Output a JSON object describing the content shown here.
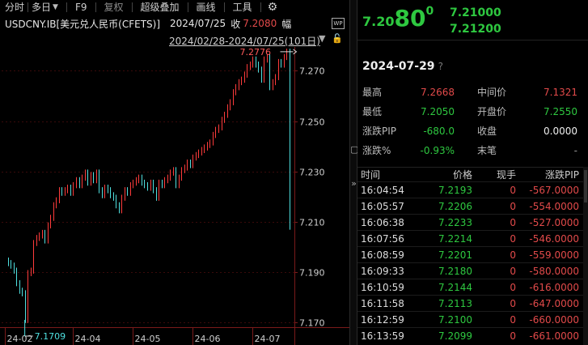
{
  "toolbar": {
    "time_label": "分时",
    "freq_label": "多日",
    "f9_label": "F9",
    "restore_label": "复权",
    "overlay_label": "超级叠加",
    "draw_label": "画线",
    "tools_label": "工具",
    "date": "2024/07/25",
    "close_label": "收",
    "close_value": "7.2080",
    "amp_label": "幅"
  },
  "instrument": {
    "title": "USDCNY.IB[美元兑人民币(CFETS)]",
    "range": "2024/02/28-2024/07/25(101日)",
    "wp_badge": "WP"
  },
  "quote": {
    "price_head": "7.20",
    "price_big": "80",
    "price_tail": "0",
    "bid": "7.21000",
    "ask": "7.21200"
  },
  "summary": {
    "date": "2024-07-29",
    "help": "?",
    "rows": [
      {
        "l1": "最高",
        "v1": "7.2668",
        "l2": "中间价",
        "v2": "7.1321"
      },
      {
        "l1": "最低",
        "v1": "7.2050",
        "l2": "开盘价",
        "v2": "7.2550"
      },
      {
        "l1": "涨跌PIP",
        "v1": "-680.0",
        "l2": "收盘",
        "v2": "0.0000"
      },
      {
        "l1": "涨跌%",
        "v1": "-0.93%",
        "l2": "末笔",
        "v2": "-"
      }
    ]
  },
  "trades": {
    "headers": [
      "时间",
      "价格",
      "现手",
      "涨跌PIP"
    ],
    "rows": [
      {
        "time": "16:04:54",
        "price": "7.2193",
        "vol": "0",
        "pip": "-567.0000"
      },
      {
        "time": "16:05:57",
        "price": "7.2206",
        "vol": "0",
        "pip": "-554.0000"
      },
      {
        "time": "16:06:38",
        "price": "7.2233",
        "vol": "0",
        "pip": "-527.0000"
      },
      {
        "time": "16:07:56",
        "price": "7.2214",
        "vol": "0",
        "pip": "-546.0000"
      },
      {
        "time": "16:08:59",
        "price": "7.2201",
        "vol": "0",
        "pip": "-559.0000"
      },
      {
        "time": "16:09:33",
        "price": "7.2180",
        "vol": "0",
        "pip": "-580.0000"
      },
      {
        "time": "16:10:59",
        "price": "7.2144",
        "vol": "0",
        "pip": "-616.0000"
      },
      {
        "time": "16:11:58",
        "price": "7.2113",
        "vol": "0",
        "pip": "-647.0000"
      },
      {
        "time": "16:12:59",
        "price": "7.2100",
        "vol": "0",
        "pip": "-660.0000"
      },
      {
        "time": "16:13:59",
        "price": "7.2099",
        "vol": "0",
        "pip": "-661.0000"
      }
    ]
  },
  "chart_data": {
    "type": "line",
    "y_axis_ticks": [
      "7.270",
      "7.250",
      "7.230",
      "7.210",
      "7.190",
      "7.170"
    ],
    "ylim": [
      7.168,
      7.2795
    ],
    "x_axis_ticks": [
      "24-02",
      "24-04",
      "24-05",
      "24-06",
      "24-07"
    ],
    "max_label": "7.2776",
    "min_label": "7.1709",
    "series": [
      {
        "values": [
          7.1945,
          7.1935,
          7.1925,
          7.1905,
          7.1855,
          7.1825,
          7.1815,
          7.1709,
          7.1895,
          7.1905,
          7.2015,
          7.2035,
          7.2045,
          7.2055,
          7.2025,
          7.2085,
          7.2115,
          7.2165,
          7.2185,
          7.2225,
          7.2215,
          7.2225,
          7.2235,
          7.2215,
          7.2245,
          7.2265,
          7.2245,
          7.2275,
          7.2295,
          7.2255,
          7.2285,
          7.2265,
          7.2295,
          7.2225,
          7.2205,
          7.2235,
          7.2225,
          7.2205,
          7.2195,
          7.2165,
          7.2145,
          7.2195,
          7.2225,
          7.2215,
          7.2245,
          7.2255,
          7.2265,
          7.2275,
          7.2255,
          7.2245,
          7.2235,
          7.2255,
          7.2225,
          7.2195,
          7.2255,
          7.2245,
          7.2265,
          7.2275,
          7.2295,
          7.2305,
          7.2245,
          7.2275,
          7.2305,
          7.2315,
          7.2335,
          7.2325,
          7.2355,
          7.2365,
          7.2375,
          7.2385,
          7.2395,
          7.2405,
          7.2415,
          7.2445,
          7.2465,
          7.2475,
          7.2505,
          7.2525,
          7.2555,
          7.2575,
          7.2615,
          7.2635,
          7.2655,
          7.2665,
          7.2685,
          7.2715,
          7.2725,
          7.2745,
          7.2725,
          7.2705,
          7.2665,
          7.2745,
          7.2755,
          7.2635,
          7.2655,
          7.2675,
          7.2735,
          7.2725,
          7.2755,
          7.2776,
          7.208
        ]
      }
    ]
  }
}
